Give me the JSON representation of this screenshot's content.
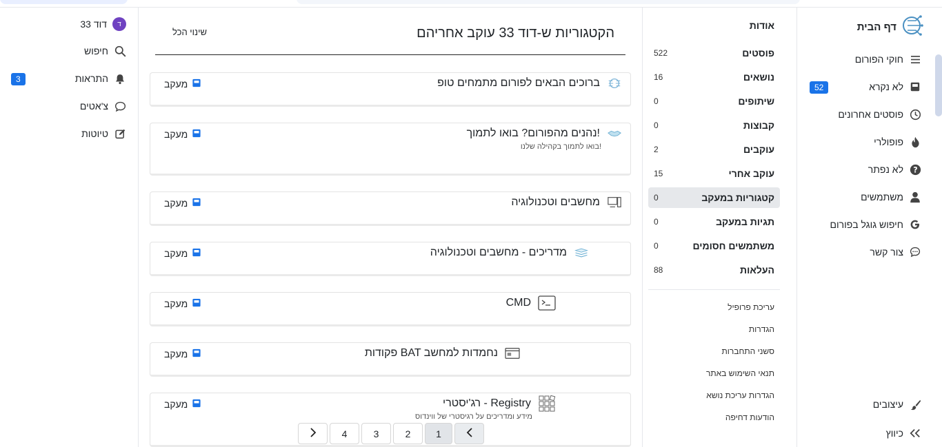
{
  "left": {
    "user_name": "דוד 33",
    "avatar_letter": "ד",
    "search": "חיפוש",
    "notifications": "התראות",
    "notifications_count": "3",
    "chats": "צ'אטים",
    "drafts": "טיוטות"
  },
  "main": {
    "title": "הקטגוריות ש-דוד 33 עוקב אחריהם",
    "change_all": "שינוי הכל",
    "follow_label": "מעקב",
    "categories": [
      {
        "title": "ברוכים הבאים לפורום מתמחים טופ",
        "desc": ""
      },
      {
        "title": "נהנים מהפורום? בואו לתמוך!",
        "desc": "בואו לתמוך בקהילה שלנו!"
      },
      {
        "title": "מחשבים וטכנולוגיה",
        "desc": ""
      },
      {
        "title": "מדריכים - מחשבים וטכנולוגיה",
        "desc": ""
      },
      {
        "title": "CMD",
        "desc": ""
      },
      {
        "title": "פקודות BAT נחמדות למחשב",
        "desc": ""
      },
      {
        "title": "רג'יסטרי - Registry",
        "desc": "מידע ומדריכים על רגיסטרי של ווינדוס"
      }
    ],
    "pager": {
      "pages": [
        "1",
        "2",
        "3",
        "4"
      ]
    }
  },
  "profile": {
    "about": "אודות",
    "stats": [
      {
        "label": "פוסטים",
        "value": "522"
      },
      {
        "label": "נושאים",
        "value": "16"
      },
      {
        "label": "שיתופים",
        "value": "0"
      },
      {
        "label": "קבוצות",
        "value": "0"
      },
      {
        "label": "עוקבים",
        "value": "2"
      },
      {
        "label": "עוקב אחרי",
        "value": "15"
      },
      {
        "label": "קטגוריות במעקב",
        "value": "0"
      },
      {
        "label": "תגיות במעקב",
        "value": "0"
      },
      {
        "label": "משתמשים חסומים",
        "value": "0"
      },
      {
        "label": "העלאות",
        "value": "88"
      }
    ],
    "links": [
      "עריכת פרופיל",
      "הגדרות",
      "סשני התחברות",
      "תנאי השימוש באתר",
      "הגדרות עריכת נושא",
      "הודעות דחיפה"
    ]
  },
  "sidebar": {
    "home": "דף הבית",
    "items": [
      {
        "label": "חוקי הפורום",
        "icon": "list-icon"
      },
      {
        "label": "לא נקרא",
        "icon": "inbox-icon"
      },
      {
        "label": "פוסטים אחרונים",
        "icon": "clock-icon"
      },
      {
        "label": "פופולרי",
        "icon": "fire-icon"
      },
      {
        "label": "לא נפתר",
        "icon": "question-icon"
      },
      {
        "label": "משתמשים",
        "icon": "user-icon"
      },
      {
        "label": "חיפוש גוגל בפורום",
        "icon": "google-icon"
      },
      {
        "label": "צור קשר",
        "icon": "chat-icon"
      }
    ],
    "unread_count": "52",
    "themes": "עיצובים",
    "direction": "כיווץ"
  },
  "colors": {
    "accent": "#1a73e8",
    "avatar": "#6f42c1"
  }
}
